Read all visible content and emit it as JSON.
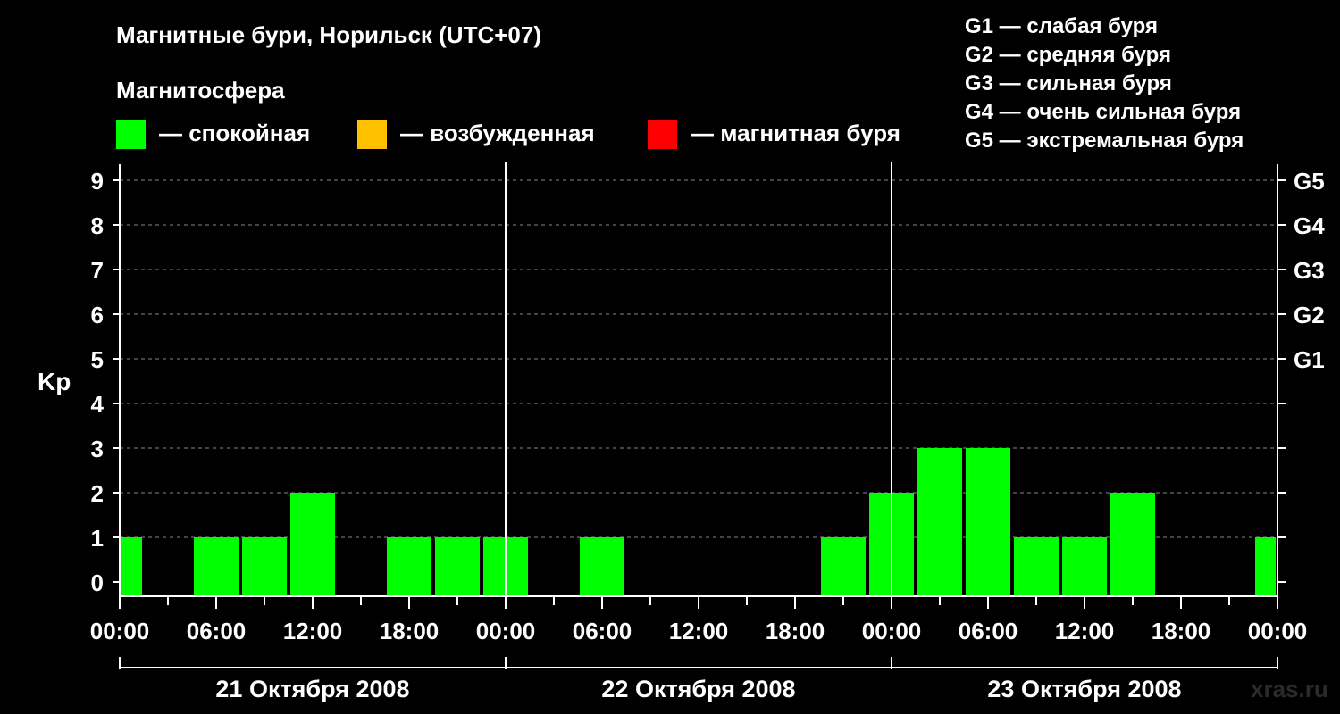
{
  "title": "Магнитные бури, Норильск (UTC+07)",
  "subtitle": "Магнитосфера",
  "legend": [
    {
      "label": "— спокойная",
      "color": "#00ff00"
    },
    {
      "label": "— возбужденная",
      "color": "#ffc000"
    },
    {
      "label": "— магнитная буря",
      "color": "#ff0000"
    }
  ],
  "g_legend": [
    "G1 — слабая буря",
    "G2 — средняя буря",
    "G3 — сильная буря",
    "G4 — очень сильная буря",
    "G5 — экстремальная буря"
  ],
  "watermark": "xras.ru",
  "chart_data": {
    "type": "bar",
    "ylabel": "Kp",
    "ylim": [
      0,
      9
    ],
    "yticks": [
      0,
      1,
      2,
      3,
      4,
      5,
      6,
      7,
      8,
      9
    ],
    "g_levels": [
      {
        "label": "G1",
        "kp": 5
      },
      {
        "label": "G2",
        "kp": 6
      },
      {
        "label": "G3",
        "kp": 7
      },
      {
        "label": "G4",
        "kp": 8
      },
      {
        "label": "G5",
        "kp": 9
      }
    ],
    "x_tick_labels": [
      "00:00",
      "06:00",
      "12:00",
      "18:00",
      "00:00",
      "06:00",
      "12:00",
      "18:00",
      "00:00",
      "06:00",
      "12:00",
      "18:00",
      "00:00"
    ],
    "days": [
      "21 Октября 2008",
      "22 Октября 2008",
      "23 Октября 2008"
    ],
    "interval_hours": 3,
    "grid": "dashed horizontal",
    "colors": {
      "calm": "#00ff00",
      "excited": "#ffc000",
      "storm": "#ff0000"
    },
    "values": [
      1,
      0,
      1,
      1,
      2,
      0,
      1,
      1,
      1,
      0,
      1,
      0,
      0,
      0,
      0,
      1,
      2,
      3,
      3,
      1,
      1,
      2,
      0,
      0,
      1
    ]
  }
}
